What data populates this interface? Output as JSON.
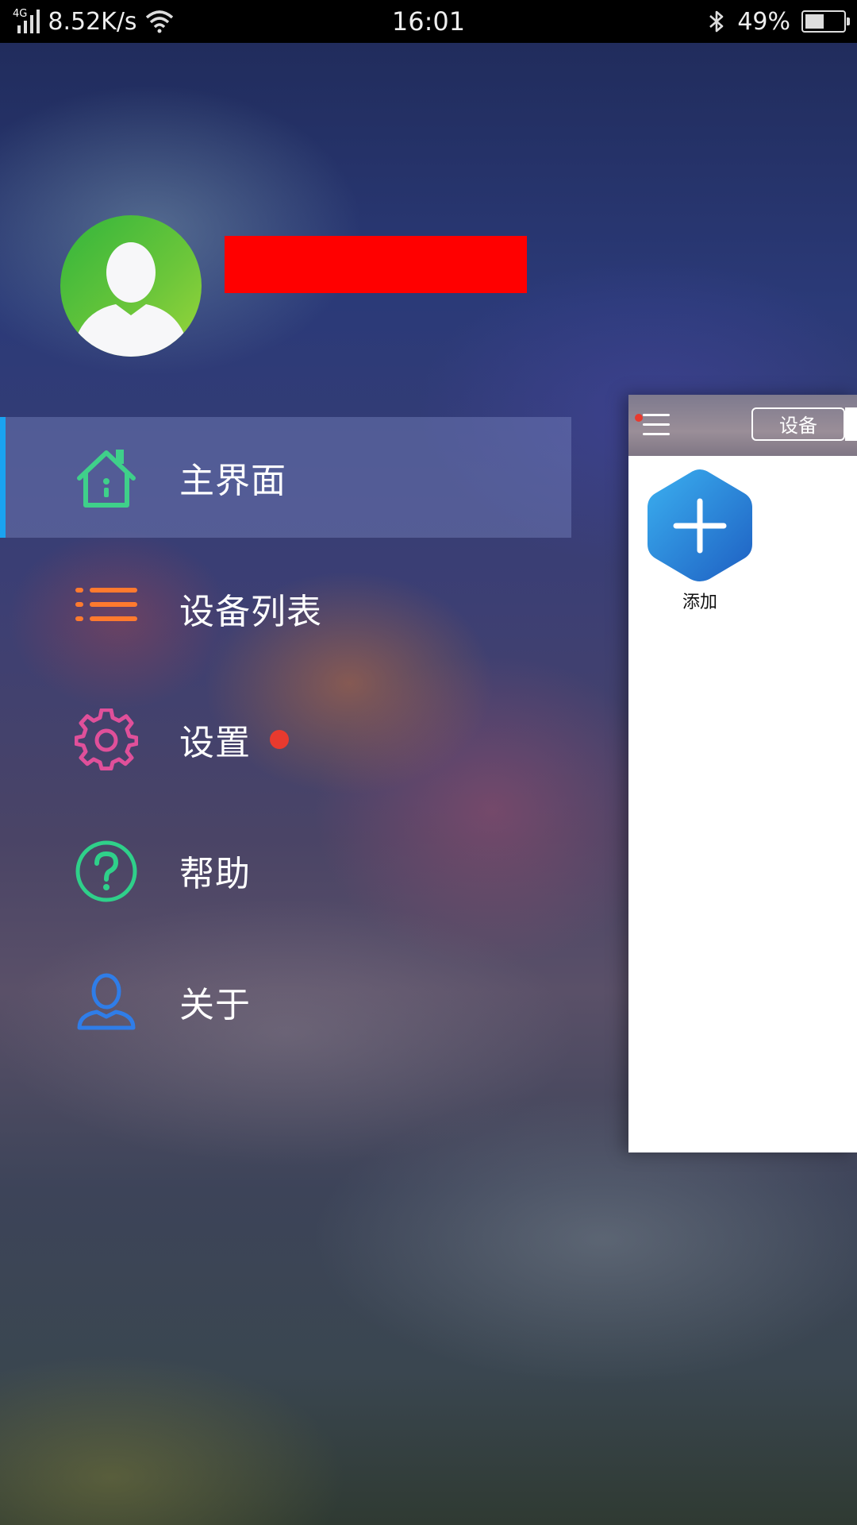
{
  "status_bar": {
    "network": "4G",
    "speed": "8.52K/s",
    "time": "16:01",
    "battery_percent": "49%",
    "battery_level": 0.49
  },
  "profile": {
    "name_redacted": true
  },
  "menu": {
    "items": [
      {
        "label": "主界面",
        "icon": "home-icon",
        "color": "#3fd08a",
        "active": true
      },
      {
        "label": "设备列表",
        "icon": "list-icon",
        "color": "#ff7a2e",
        "active": false
      },
      {
        "label": "设置",
        "icon": "gear-icon",
        "color": "#e0509a",
        "active": false,
        "badge": true
      },
      {
        "label": "帮助",
        "icon": "help-icon",
        "color": "#2fd08a",
        "active": false
      },
      {
        "label": "关于",
        "icon": "user-icon",
        "color": "#2f7de8",
        "active": false
      }
    ]
  },
  "preview": {
    "tab_label": "设备",
    "add_label": "添加"
  },
  "colors": {
    "accent": "#1aa3f0",
    "badge": "#e83a2e"
  }
}
